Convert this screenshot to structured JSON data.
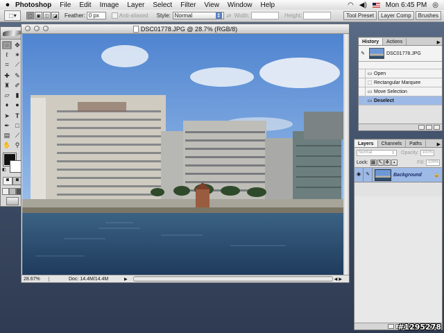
{
  "menubar": {
    "app_name": "Photoshop",
    "items": [
      "File",
      "Edit",
      "Image",
      "Layer",
      "Select",
      "Filter",
      "View",
      "Window",
      "Help"
    ],
    "clock": "Mon 6:45 PM"
  },
  "options": {
    "feather_label": "Feather:",
    "feather_value": "0 px",
    "antialiased_label": "Anti-aliased",
    "style_label": "Style:",
    "style_value": "Normal",
    "width_label": "Width:",
    "height_label": "Height:",
    "well_tabs": [
      "Tool Preset",
      "Layer Comp",
      "Brushes"
    ]
  },
  "document": {
    "title": "DSC01778.JPG @ 28.7% (RGB/8)",
    "zoom": "28.67%",
    "doc_size": "Doc: 14.4M/14.4M"
  },
  "history": {
    "tabs": [
      "History",
      "Actions"
    ],
    "snapshot": "DSC01778.JPG",
    "steps": [
      {
        "label": "Open",
        "icon": "open-step-icon"
      },
      {
        "label": "Rectangular Marquee",
        "icon": "marquee-step-icon"
      },
      {
        "label": "Move Selection",
        "icon": "move-step-icon"
      },
      {
        "label": "Deselect",
        "icon": "deselect-step-icon",
        "selected": true
      }
    ]
  },
  "layers": {
    "tabs": [
      "Layers",
      "Channels",
      "Paths"
    ],
    "blend_mode": "Normal",
    "opacity_label": "Opacity:",
    "opacity_value": "100%",
    "lock_label": "Lock:",
    "fill_label": "Fill:",
    "fill_value": "100%",
    "layer_name": "Background"
  },
  "watermark": "#1295278",
  "colors": {
    "selection": "#9db9e6",
    "sky": "#5b8fd6",
    "water": "#2e4f72"
  }
}
